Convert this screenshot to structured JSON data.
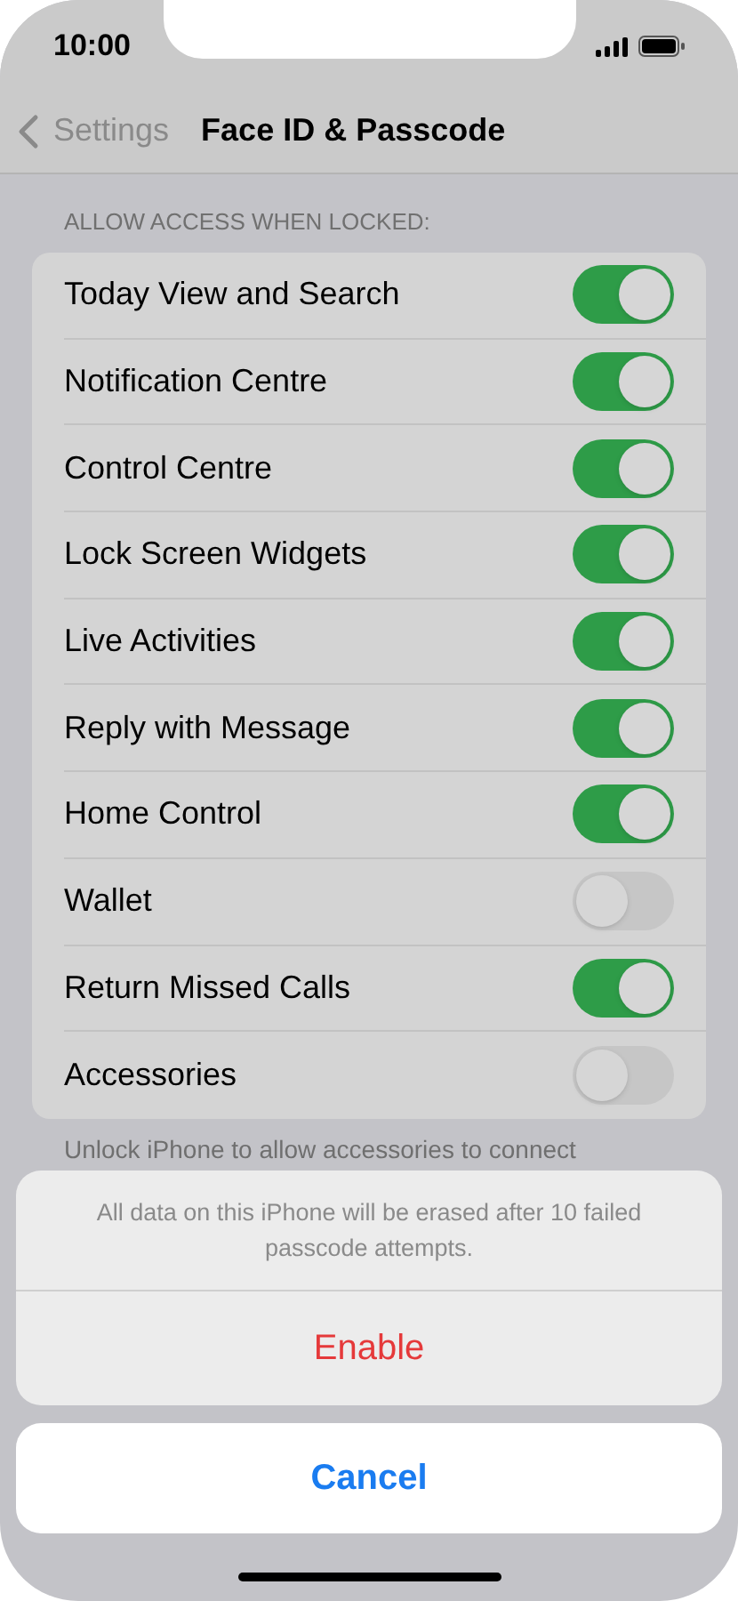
{
  "status_bar": {
    "time": "10:00"
  },
  "nav": {
    "back": "Settings",
    "title": "Face ID & Passcode"
  },
  "section": {
    "header": "ALLOW ACCESS WHEN LOCKED:",
    "rows": [
      {
        "label": "Today View and Search",
        "on": true
      },
      {
        "label": "Notification Centre",
        "on": true
      },
      {
        "label": "Control Centre",
        "on": true
      },
      {
        "label": "Lock Screen Widgets",
        "on": true
      },
      {
        "label": "Live Activities",
        "on": true
      },
      {
        "label": "Reply with Message",
        "on": true
      },
      {
        "label": "Home Control",
        "on": true
      },
      {
        "label": "Wallet",
        "on": false
      },
      {
        "label": "Return Missed Calls",
        "on": true
      },
      {
        "label": "Accessories",
        "on": false
      }
    ],
    "footer": "Unlock iPhone to allow accessories to connect"
  },
  "action_sheet": {
    "message": "All data on this iPhone will be erased after 10 failed passcode attempts.",
    "actions": [
      {
        "label": "Enable",
        "kind": "destructive"
      }
    ],
    "cancel": "Cancel"
  }
}
